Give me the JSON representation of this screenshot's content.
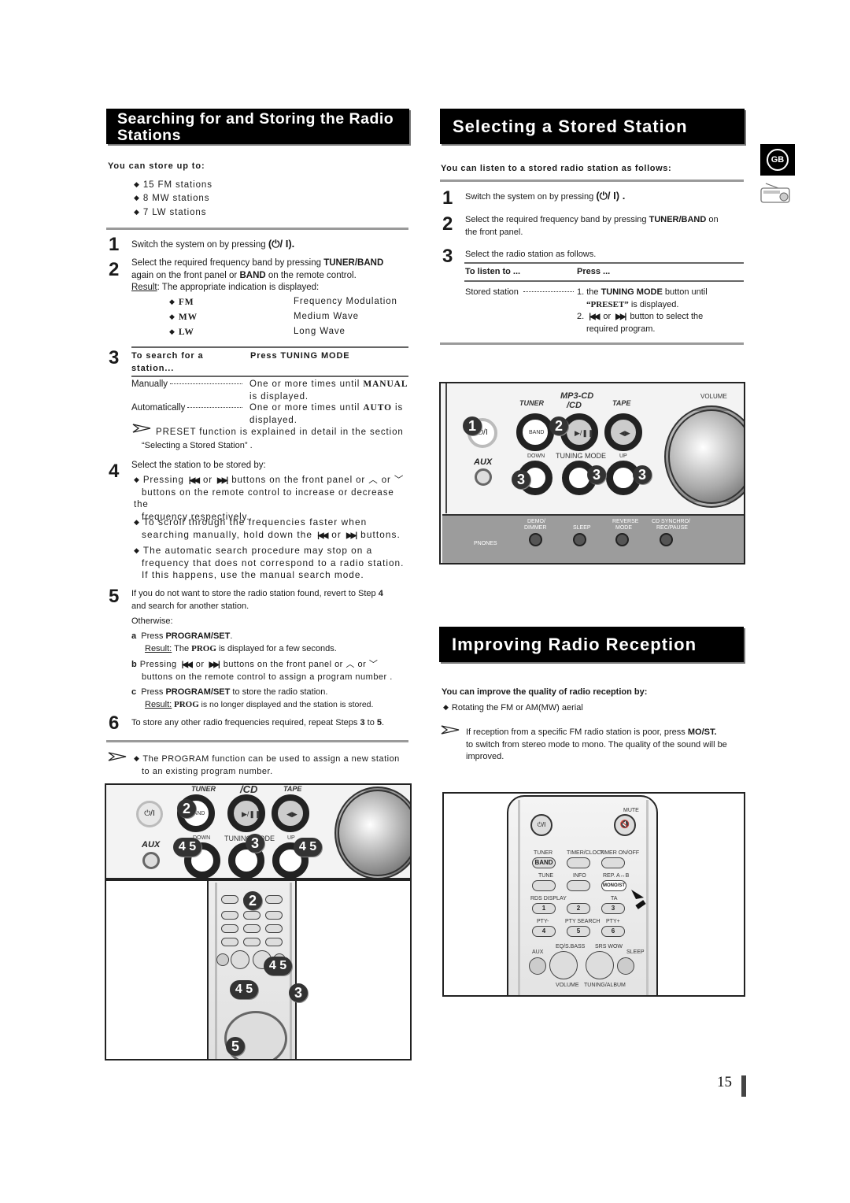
{
  "left": {
    "title": "Searching for and Storing the Radio Stations",
    "store_heading": "You can store up to:",
    "store_items": [
      "15 FM stations",
      "8 MW stations",
      "7 LW stations"
    ],
    "step1": {
      "num": "1",
      "text": "Switch the system on by pressing",
      "symbol": "(⏻/ I)."
    },
    "step2": {
      "num": "2",
      "text_a": "Select the required frequency band by pressing ",
      "bold_a": "TUNER/BAND",
      "text_b": "again on the front panel or ",
      "bold_b": "BAND",
      "text_c": " on the remote control.",
      "result_label": "Result",
      "result_text": ": The appropriate indication is displayed:",
      "bands": [
        {
          "code": "FM",
          "name": "Frequency Modulation"
        },
        {
          "code": "MW",
          "name": "Medium Wave"
        },
        {
          "code": "LW",
          "name": "Long Wave"
        }
      ]
    },
    "step3": {
      "num": "3",
      "col1": "To search for a station...",
      "col2": "Press TUNING MODE",
      "rows": [
        {
          "label": "Manually",
          "text_a": "One or more times until ",
          "bold": "MANUAL",
          "text_b": "is displayed."
        },
        {
          "label": "Automatically",
          "text_a": "One or more times until ",
          "bold": "AUTO",
          "text_b": " is",
          "text_c": "displayed."
        }
      ],
      "note_a": "PRESET function is explained in detail in the section",
      "note_b": "“Selecting a Stored Station” ."
    },
    "step4": {
      "num": "4",
      "intro": "Select the station to be stored by:",
      "b1_a": "Pressing",
      "b1_or": "or",
      "b1_b": "buttons on the front panel or",
      "b1_or2": "or",
      "b1_c": "buttons on the remote control to increase or decrease the",
      "b1_d": "frequency respectively.",
      "b2_a": "To scroll through the frequencies faster when",
      "b2_b": "searching manually, hold down the",
      "b2_or": "or",
      "b2_c": "buttons.",
      "b3_a": "The automatic search procedure may stop on a",
      "b3_b": "frequency that does not correspond to a radio station.",
      "b3_c": "If this happens, use the manual search mode."
    },
    "step5": {
      "num": "5",
      "text_a": "If you do not want to store the radio station found, revert to Step ",
      "bold_a": "4",
      "text_b": "and search for another station.",
      "otherwise": "Otherwise:",
      "a_label": "a",
      "a_text": "Press ",
      "a_bold": "PROGRAM/SET",
      "a_end": ".",
      "a_result_label": "Result:",
      "a_result_a": " The ",
      "a_result_bold": "PROG",
      "a_result_b": " is displayed for a few seconds.",
      "b_label": "b",
      "b_text_a": "Pressing",
      "b_or": "or",
      "b_text_b": "buttons on the front panel or",
      "b_or2": "or",
      "b_text_c": "buttons on the remote control to assign a program number .",
      "c_label": "c",
      "c_text": "Press ",
      "c_bold": "PROGRAM/SET",
      "c_end": " to store the radio station.",
      "c_result_label": "Result:",
      "c_result_bold": " PROG ",
      "c_result_b": " is no longer displayed and the station is stored."
    },
    "step6": {
      "num": "6",
      "text_a": "To store any other radio frequencies required, repeat Steps ",
      "b1": "3",
      "mid": " to ",
      "b2": "5",
      "end": "."
    },
    "note": {
      "a": "The PROGRAM function can be used to assign a new station",
      "b": "to an existing program number."
    },
    "figure_panel": {
      "labels": {
        "tuner": "TUNER",
        "cd": "/CD",
        "tape": "TAPE",
        "band": "BAND",
        "aux": "AUX",
        "down": "DOWN",
        "tuning_mode": "TUNING MODE",
        "up": "UP",
        "power": "⏻/I"
      },
      "badges": [
        "2",
        "4 5",
        "3",
        "4 5"
      ]
    },
    "figure_remote": {
      "badges": [
        "2",
        "4 5",
        "4 5",
        "3",
        "5"
      ]
    }
  },
  "right": {
    "title": "Selecting a Stored Station",
    "heading": "You can listen to a stored radio station as follows:",
    "step1": {
      "num": "1",
      "text": "Switch the system on by pressing",
      "symbol": "(⏻/ I) ."
    },
    "step2": {
      "num": "2",
      "text_a": "Select the required frequency band by pressing ",
      "bold": "TUNER/BAND",
      "text_b": " on",
      "text_c": "the front panel."
    },
    "step3": {
      "num": "3",
      "intro": "Select the radio station as follows.",
      "col1": "To listen to ...",
      "col2": "Press ...",
      "row_label": "Stored station",
      "item1_a": "1. the ",
      "item1_bold": "TUNING MODE",
      "item1_b": " button until",
      "item1_c_serif": "“PRESET”",
      "item1_c": " is displayed.",
      "item2_a": "2.",
      "item2_or": "or",
      "item2_b": "button to select the",
      "item2_c": "required program."
    },
    "figure_panel": {
      "labels": {
        "tuner": "TUNER",
        "mp3cd": "MP3-CD",
        "cd": "/CD",
        "tape": "TAPE",
        "volume": "VOLUME",
        "band": "BAND",
        "aux": "AUX",
        "down": "DOWN",
        "tuning_mode": "TUNING MODE",
        "up": "UP",
        "demo": "DEMO/",
        "dimmer": "DIMMER",
        "sleep": "SLEEP",
        "reverse": "REVERSE",
        "mode": "MODE",
        "cdsync": "CD SYNCHRO/",
        "recpause": "REC/PAUSE",
        "phones": "PNONES",
        "power": "⏻/I"
      },
      "badges": [
        "1",
        "2",
        "3",
        "3",
        "3"
      ]
    },
    "reception": {
      "title": "Improving Radio Reception",
      "heading": "You can improve the quality of radio reception by:",
      "bullet": "Rotating the FM or AM(MW) aerial",
      "note_a": "If reception from a specific FM radio station is poor, press ",
      "note_bold": "MO/ST.",
      "note_b": "to switch from stereo mode to mono. The quality of the sound will be",
      "note_c": "improved."
    },
    "figure_remote": {
      "labels": {
        "mute": "MUTE",
        "power": "⏻/I",
        "tuner": "TUNER",
        "timerclock": "TIMER/CLOCK",
        "timeronoff": "TIMER ON/OFF",
        "band": "BAND",
        "tune": "TUNE",
        "info": "INFO",
        "rep": "REP. A↔B",
        "monost": "MONO/ST",
        "rds": "RDS DISPLAY",
        "ta": "TA",
        "k1": "1",
        "k2": "2",
        "k3": "3",
        "ptym": "PTY-",
        "ptysearch": "PTY SEARCH",
        "ptyp": "PTY+",
        "k4": "4",
        "k5": "5",
        "k6": "6",
        "aux": "AUX",
        "eq": "EQ/S.BASS",
        "srs": "SRS WOW",
        "sleep": "SLEEP",
        "volume": "VOLUME",
        "tuningalbum": "TUNING/ALBUM",
        "tuning": "TUNING"
      }
    }
  },
  "side": {
    "lang_badge": "GB",
    "icon": "radio-icon"
  },
  "page_number": "15"
}
